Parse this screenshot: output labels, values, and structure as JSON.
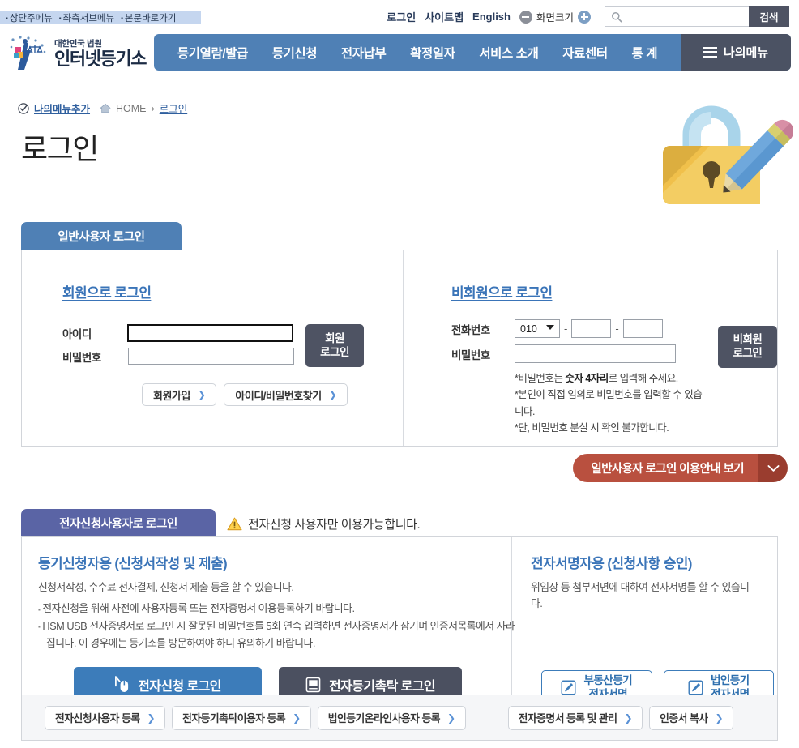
{
  "skip_links": [
    "상단주메뉴",
    "좌측서브메뉴",
    "본문바로가기"
  ],
  "utility": {
    "login": "로그인",
    "sitemap": "사이트맵",
    "english": "English",
    "zoom_label": "화면크기",
    "zoom_out_icon": "minus-circle-icon",
    "zoom_in_icon": "plus-circle-icon",
    "search_icon": "search-icon",
    "search_value": "",
    "search_placeholder": "",
    "search_button": "검색"
  },
  "brand": {
    "small": "대한민국 법원",
    "big": "인터넷등기소",
    "logo_icon": "scales-of-justice-logo"
  },
  "nav": {
    "items": [
      "등기열람/발급",
      "등기신청",
      "전자납부",
      "확정일자",
      "서비스 소개",
      "자료센터",
      "통 계"
    ],
    "mymenu": "나의메뉴",
    "mymenu_icon": "hamburger-icon"
  },
  "breadcrumb": {
    "add_my_menu": "나의메뉴추가",
    "add_icon": "check-circle-icon",
    "home_icon": "home-icon",
    "home": "HOME",
    "sep": "›",
    "current": "로그인"
  },
  "page_title": "로그인",
  "hero_icon": "padlock-with-pencil-illustration",
  "general_tab": {
    "label": "일반사용자 로그인",
    "member": {
      "heading": "회원으로 로그인",
      "id_label": "아이디",
      "id_value": "",
      "pw_label": "비밀번호",
      "pw_value": "",
      "login_button_line1": "회원",
      "login_button_line2": "로그인",
      "join_button": "회원가입",
      "find_button": "아이디/비밀번호찾기",
      "chevron": "❯"
    },
    "nonmember": {
      "heading": "비회원으로 로그인",
      "phone_label": "전화번호",
      "phone_prefix": "010",
      "phone_mid": "",
      "phone_last": "",
      "dash": "-",
      "pw_label": "비밀번호",
      "pw_value": "",
      "login_button_line1": "비회원",
      "login_button_line2": "로그인",
      "notes": [
        "비밀번호는 숫자 4자리로 입력해 주세요.",
        "본인이 직접 임의로 비밀번호를 입력할 수 있습니다.",
        "단, 비밀번호 분실 시 확인 불가합니다."
      ],
      "note_bold": "숫자 4자리",
      "note_prefix": "비밀번호는 ",
      "note_suffix": "로 입력해 주세요."
    }
  },
  "guide_bar": {
    "label": "일반사용자 로그인 이용안내 보기",
    "chevron_icon": "chevron-down-icon"
  },
  "edoc_tab": {
    "label": "전자신청사용자로 로그인",
    "warning_icon": "warning-triangle-icon",
    "warning_text": "전자신청 사용자만 이용가능합니다.",
    "left": {
      "heading": "등기신청자용 (신청서작성 및 제출)",
      "desc": "신청서작성, 수수료 전자결제, 신청서 제출 등을 할 수 있습니다.",
      "bullets": [
        "전자신청을 위해 사전에 사용자등록 또는 전자증명서 이용등록하기 바랍니다.",
        "HSM USB 전자증명서로 로그인 시 잘못된 비밀번호를 5회 연속 입력하면 전자증명서가 잠기며 인증서목록에서 사라집니다. 이 경우에는 등기소를 방문하여야 하니 유의하기 바랍니다."
      ],
      "buttons": [
        {
          "label": "전자신청 로그인",
          "icon": "mouse-pointer-icon",
          "style": "blue"
        },
        {
          "label": "전자등기촉탁 로그인",
          "icon": "id-card-icon",
          "style": "gray"
        }
      ],
      "footer_buttons": [
        "전자신청사용자 등록",
        "전자등기촉탁이용자 등록",
        "법인등기온라인사용자 등록"
      ]
    },
    "right": {
      "heading": "전자서명자용 (신청사항 승인)",
      "desc": "위임장 등 첨부서면에 대하여 전자서명를 할 수 있습니다.",
      "buttons": [
        {
          "line1": "부동산등기",
          "line2": "전자서명",
          "icon": "pencil-square-icon"
        },
        {
          "line1": "법인등기",
          "line2": "전자서명",
          "icon": "pencil-square-icon"
        }
      ],
      "footer_buttons": [
        "전자증명서 등록 및 관리",
        "인증서 복사"
      ]
    },
    "chevron": "❯"
  },
  "colors": {
    "nav_blue": "#4f80b5",
    "mymenu_dark": "#4b5263",
    "tab_purple": "#5a64a5",
    "guide_red": "#b9503f",
    "heading_blue": "#3a74b8",
    "button_dark": "#4e5363",
    "button_blue": "#3c7cba",
    "skip_bg": "#c5d6ef"
  }
}
